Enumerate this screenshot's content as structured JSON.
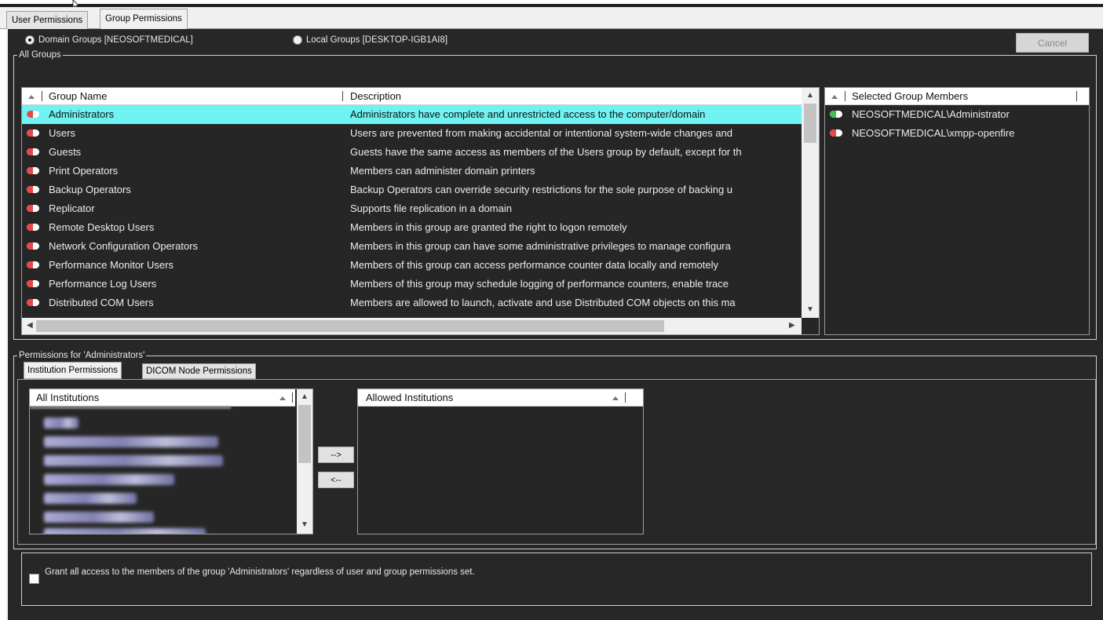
{
  "tabs": [
    {
      "label": "User Permissions",
      "active": false
    },
    {
      "label": "Group Permissions",
      "active": true
    }
  ],
  "all_groups": {
    "legend": "All Groups",
    "domain_radio": "Domain Groups [NEOSOFTMEDICAL]",
    "local_radio": "Local Groups [DESKTOP-IGB1AI8]",
    "selected_radio": "domain",
    "cancel_label": "Cancel",
    "columns": {
      "name": "Group Name",
      "description": "Description"
    },
    "rows": [
      {
        "name": "Administrators",
        "description": "Administrators have complete and unrestricted access to the computer/domain",
        "selected": true
      },
      {
        "name": "Users",
        "description": "Users are prevented from making accidental or intentional system-wide changes and"
      },
      {
        "name": "Guests",
        "description": "Guests have the same access as members of the Users group by default, except for th"
      },
      {
        "name": "Print Operators",
        "description": "Members can administer domain printers"
      },
      {
        "name": "Backup Operators",
        "description": "Backup Operators can override security restrictions for the sole purpose of backing u"
      },
      {
        "name": "Replicator",
        "description": "Supports file replication in a domain"
      },
      {
        "name": "Remote Desktop Users",
        "description": "Members in this group are granted the right to logon remotely"
      },
      {
        "name": "Network Configuration Operators",
        "description": "Members in this group can have some administrative privileges to manage configura"
      },
      {
        "name": "Performance Monitor Users",
        "description": "Members of this group can access performance counter data locally and remotely"
      },
      {
        "name": "Performance Log Users",
        "description": "Members of this group may schedule logging of performance counters, enable trace"
      },
      {
        "name": "Distributed COM Users",
        "description": "Members are allowed to launch, activate and use Distributed COM objects on this ma"
      }
    ],
    "members_header": "Selected Group Members",
    "members": [
      {
        "name": "NEOSOFTMEDICAL\\Administrator",
        "status_color": "#3fbf56"
      },
      {
        "name": "NEOSOFTMEDICAL\\xmpp-openfire",
        "status_color": "#e8474a"
      }
    ]
  },
  "permissions": {
    "legend": "Permissions for 'Administrators'",
    "subtabs": [
      {
        "label": "Institution Permissions",
        "active": true
      },
      {
        "label": "DICOM Node Permissions",
        "active": false
      }
    ],
    "all_institutions_header": "All Institutions",
    "allowed_institutions_header": "Allowed Institutions",
    "add_label": "-->",
    "remove_label": "<--",
    "grant_text": "Grant all access to the members of the group 'Administrators' regardless of user and group permissions set.",
    "grant_checked": false
  },
  "colors": {
    "panel_bg": "#272727",
    "selected_row": "#6ef2f2",
    "status_red": "#e8474a",
    "status_green": "#3fbf56"
  }
}
